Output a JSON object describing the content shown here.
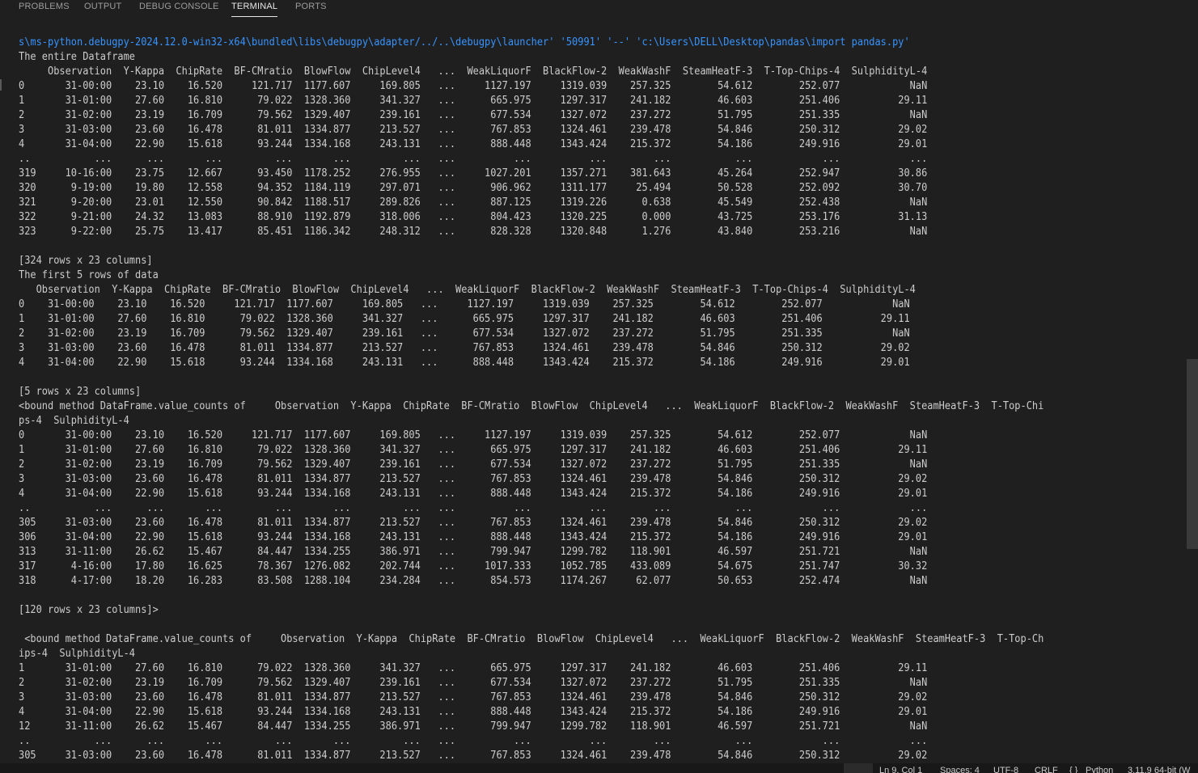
{
  "panel": {
    "tabs": [
      {
        "label": "PROBLEMS"
      },
      {
        "label": "OUTPUT"
      },
      {
        "label": "DEBUG CONSOLE"
      },
      {
        "label": "TERMINAL"
      },
      {
        "label": "PORTS"
      }
    ],
    "active_tab": "TERMINAL"
  },
  "terminal": {
    "lines": [
      "s\\ms-python.debugpy-2024.12.0-win32-x64\\bundled\\libs\\debugpy\\adapter/../..\\debugpy\\launcher' '50991' '--' 'c:\\Users\\DELL\\Desktop\\pandas\\import pandas.py'",
      "The entire Dataframe",
      "     Observation  Y-Kappa  ChipRate  BF-CMratio  BlowFlow  ChipLevel4   ...  WeakLiquorF  BlackFlow-2  WeakWashF  SteamHeatF-3  T-Top-Chips-4  SulphidityL-4",
      "0       31-00:00    23.10    16.520     121.717  1177.607     169.805   ...     1127.197     1319.039    257.325        54.612        252.077            NaN",
      "1       31-01:00    27.60    16.810      79.022  1328.360     341.327   ...      665.975     1297.317    241.182        46.603        251.406          29.11",
      "2       31-02:00    23.19    16.709      79.562  1329.407     239.161   ...      677.534     1327.072    237.272        51.795        251.335            NaN",
      "3       31-03:00    23.60    16.478      81.011  1334.877     213.527   ...      767.853     1324.461    239.478        54.846        250.312          29.02",
      "4       31-04:00    22.90    15.618      93.244  1334.168     243.131   ...      888.448     1343.424    215.372        54.186        249.916          29.01",
      "..           ...      ...       ...         ...       ...         ...   ...          ...          ...        ...           ...            ...            ...",
      "319     10-16:00    23.75    12.667      93.450  1178.252     276.955   ...     1027.201     1357.271    381.643        45.264        252.947          30.86",
      "320      9-19:00    19.80    12.558      94.352  1184.119     297.071   ...      906.962     1311.177     25.494        50.528        252.092          30.70",
      "321      9-20:00    23.01    12.550      90.842  1188.517     289.826   ...      887.125     1319.226      0.638        45.549        252.438            NaN",
      "322      9-21:00    24.32    13.083      88.910  1192.879     318.006   ...      804.423     1320.225      0.000        43.725        253.176          31.13",
      "323      9-22:00    25.75    13.417      85.451  1186.342     248.312   ...      828.328     1320.848      1.276        43.840        253.216            NaN",
      "",
      "[324 rows x 23 columns]",
      "The first 5 rows of data",
      "   Observation  Y-Kappa  ChipRate  BF-CMratio  BlowFlow  ChipLevel4   ...  WeakLiquorF  BlackFlow-2  WeakWashF  SteamHeatF-3  T-Top-Chips-4  SulphidityL-4",
      "0    31-00:00    23.10    16.520     121.717  1177.607     169.805   ...     1127.197     1319.039    257.325        54.612        252.077            NaN",
      "1    31-01:00    27.60    16.810      79.022  1328.360     341.327   ...      665.975     1297.317    241.182        46.603        251.406          29.11",
      "2    31-02:00    23.19    16.709      79.562  1329.407     239.161   ...      677.534     1327.072    237.272        51.795        251.335            NaN",
      "3    31-03:00    23.60    16.478      81.011  1334.877     213.527   ...      767.853     1324.461    239.478        54.846        250.312          29.02",
      "4    31-04:00    22.90    15.618      93.244  1334.168     243.131   ...      888.448     1343.424    215.372        54.186        249.916          29.01",
      "",
      "[5 rows x 23 columns]",
      "<bound method DataFrame.value_counts of     Observation  Y-Kappa  ChipRate  BF-CMratio  BlowFlow  ChipLevel4   ...  WeakLiquorF  BlackFlow-2  WeakWashF  SteamHeatF-3  T-Top-Chi",
      "ps-4  SulphidityL-4",
      "0       31-00:00    23.10    16.520     121.717  1177.607     169.805   ...     1127.197     1319.039    257.325        54.612        252.077            NaN",
      "1       31-01:00    27.60    16.810      79.022  1328.360     341.327   ...      665.975     1297.317    241.182        46.603        251.406          29.11",
      "2       31-02:00    23.19    16.709      79.562  1329.407     239.161   ...      677.534     1327.072    237.272        51.795        251.335            NaN",
      "3       31-03:00    23.60    16.478      81.011  1334.877     213.527   ...      767.853     1324.461    239.478        54.846        250.312          29.02",
      "4       31-04:00    22.90    15.618      93.244  1334.168     243.131   ...      888.448     1343.424    215.372        54.186        249.916          29.01",
      "..           ...      ...       ...         ...       ...         ...   ...          ...          ...        ...           ...            ...            ...",
      "305     31-03:00    23.60    16.478      81.011  1334.877     213.527   ...      767.853     1324.461    239.478        54.846        250.312          29.02",
      "306     31-04:00    22.90    15.618      93.244  1334.168     243.131   ...      888.448     1343.424    215.372        54.186        249.916          29.01",
      "313     31-11:00    26.62    15.467      84.447  1334.255     386.971   ...      799.947     1299.782    118.901        46.597        251.721            NaN",
      "317      4-16:00    17.80    16.625      78.367  1276.082     202.744   ...     1017.333     1052.785    433.089        54.675        251.747          30.32",
      "318      4-17:00    18.20    16.283      83.508  1288.104     234.284   ...      854.573     1174.267     62.077        50.653        252.474            NaN",
      "",
      "[120 rows x 23 columns]>",
      "",
      " <bound method DataFrame.value_counts of     Observation  Y-Kappa  ChipRate  BF-CMratio  BlowFlow  ChipLevel4   ...  WeakLiquorF  BlackFlow-2  WeakWashF  SteamHeatF-3  T-Top-Ch",
      "ips-4  SulphidityL-4",
      "1       31-01:00    27.60    16.810      79.022  1328.360     341.327   ...      665.975     1297.317    241.182        46.603        251.406          29.11",
      "2       31-02:00    23.19    16.709      79.562  1329.407     239.161   ...      677.534     1327.072    237.272        51.795        251.335            NaN",
      "3       31-03:00    23.60    16.478      81.011  1334.877     213.527   ...      767.853     1324.461    239.478        54.846        250.312          29.02",
      "4       31-04:00    22.90    15.618      93.244  1334.168     243.131   ...      888.448     1343.424    215.372        54.186        249.916          29.01",
      "12      31-11:00    26.62    15.467      84.447  1334.255     386.971   ...      799.947     1299.782    118.901        46.597        251.721            NaN",
      "..           ...      ...       ...         ...       ...         ...   ...          ...          ...        ...           ...            ...            ...",
      "305     31-03:00    23.60    16.478      81.011  1334.877     213.527   ...      767.853     1324.461    239.478        54.846        250.312          29.02"
    ]
  },
  "statusbar": {
    "position": "Ln 9, Col 1",
    "spaces": "Spaces: 4",
    "encoding": "UTF-8",
    "eol": "CRLF",
    "language": "Python",
    "interpreter": "3.11.9 64-bit (W"
  },
  "colors": {
    "background": "#1f1f1f",
    "text": "#cccccc",
    "command": "#3794ff",
    "active_tab": "#e7e7e7"
  }
}
